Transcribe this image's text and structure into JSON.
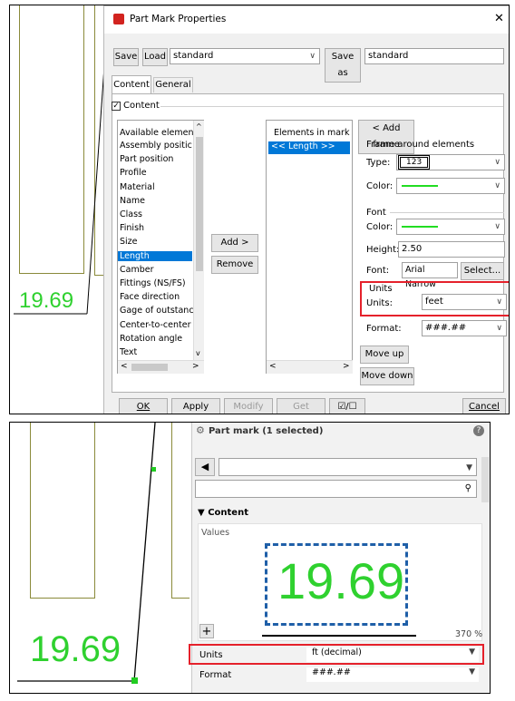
{
  "top": {
    "dialog_title": "Part Mark Properties",
    "close_glyph": "✕",
    "toolbar": {
      "save": "Save",
      "load": "Load",
      "preset": "standard",
      "save_as": "Save as",
      "save_as_name": "standard"
    },
    "tabs": [
      "Content",
      "General"
    ],
    "content_checkbox_label": "Content",
    "available_header": "Available elemen",
    "available_items": [
      "Assembly positic",
      "Part position",
      "Profile",
      "Material",
      "Name",
      "Class",
      "Finish",
      "Size",
      "Length",
      "Camber",
      "Fittings (NS/FS)",
      "Face direction",
      "Gage of outstanc",
      "Center-to-center",
      "Rotation angle",
      "Text"
    ],
    "elements_header": "Elements in mark",
    "elements_items": [
      "<< Length >>"
    ],
    "add_button": "Add >",
    "remove_button": "Remove",
    "add_frame_button": "< Add frame",
    "frame_group": "Frame around elements",
    "type_label": "Type:",
    "type_value": "123",
    "color_label": "Color:",
    "font_group": "Font",
    "font_color_label": "Color:",
    "height_label": "Height:",
    "height_value": "2.50",
    "font_label": "Font:",
    "font_value": "Arial Narrow",
    "select_button": "Select...",
    "units_group": "Units",
    "units_label": "Units:",
    "units_value": "feet",
    "format_label": "Format:",
    "format_value": "###.##",
    "move_up": "Move up",
    "move_down": "Move down",
    "bottom_buttons": {
      "ok": "OK",
      "apply": "Apply",
      "modify": "Modify",
      "get": "Get",
      "toggle": "☑/☐",
      "cancel": "Cancel"
    },
    "drawing_value": "19.69",
    "accent_green": "#22dd22",
    "highlight_red": "#e5212b"
  },
  "bottom": {
    "panel_title": "Part mark (1 selected)",
    "help_glyph": "?",
    "search_icon": "search-icon",
    "section": "Content",
    "values_label": "Values",
    "preview_value": "19.69",
    "zoom": "370 %",
    "add_glyph": "+",
    "units_label": "Units",
    "units_value": "ft (decimal)",
    "format_label": "Format",
    "format_value": "###.##",
    "drawing_value": "19.69"
  }
}
